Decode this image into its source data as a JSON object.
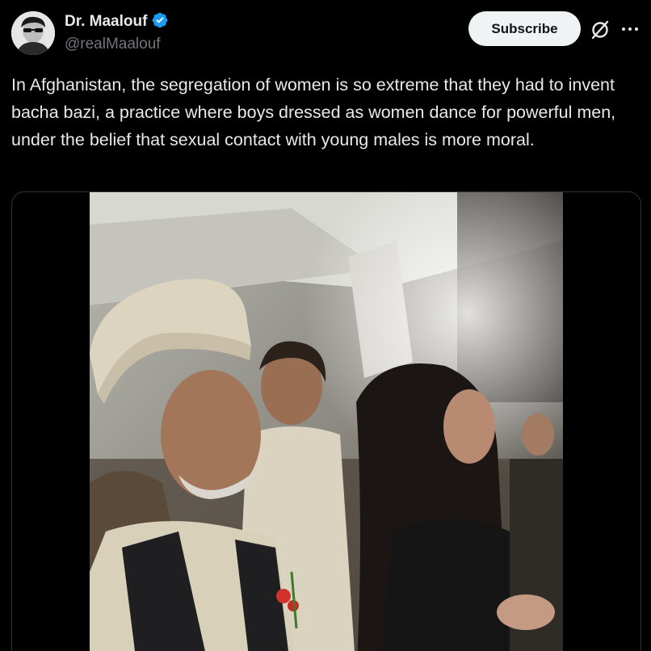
{
  "author": {
    "display_name": "Dr. Maalouf",
    "handle": "@realMaalouf",
    "verified": true,
    "verified_color": "#1d9bf0"
  },
  "actions": {
    "subscribe_label": "Subscribe",
    "grok_icon": "grok-icon",
    "more_icon": "more-horizontal-icon"
  },
  "post": {
    "text": "In Afghanistan, the segregation of women is so extreme that they had to invent bacha bazi, a practice where boys dressed as women dance for powerful men, under the belief that sexual contact with young males is more moral."
  },
  "media": {
    "type": "video"
  },
  "colors": {
    "background": "#000000",
    "text_primary": "#e7e9ea",
    "text_secondary": "#71767b",
    "border": "#2f3336",
    "button_bg": "#eff3f4"
  }
}
